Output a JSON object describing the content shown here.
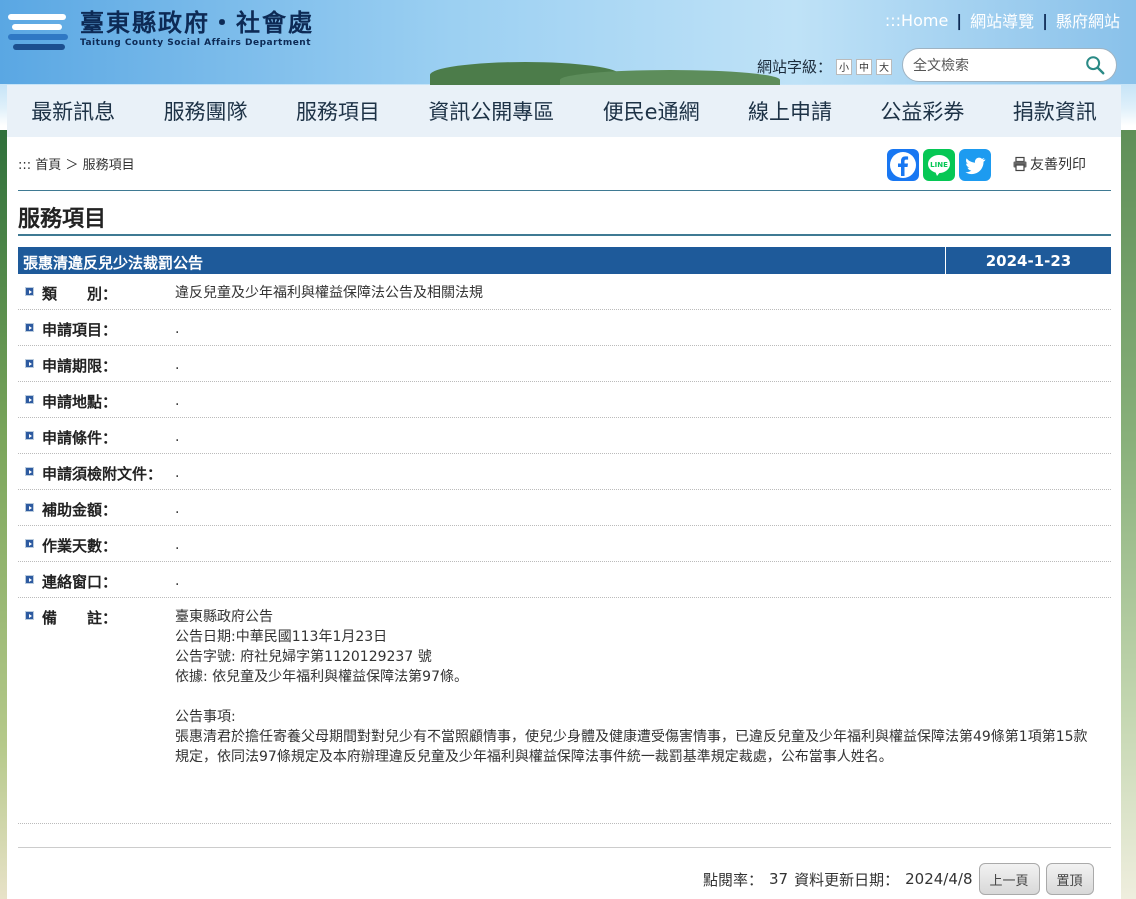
{
  "site": {
    "title": "臺東縣政府‧社會處",
    "subtitle": "Taitung County Social Affairs Department"
  },
  "toplinks": [
    ":::Home",
    "網站導覽",
    "縣府網站"
  ],
  "fontsize": {
    "label": "網站字級：",
    "small": "小",
    "medium": "中",
    "large": "大"
  },
  "search": {
    "placeholder": "全文檢索"
  },
  "nav": [
    "最新訊息",
    "服務團隊",
    "服務項目",
    "資訊公開專區",
    "便民e通網",
    "線上申請",
    "公益彩券",
    "捐款資訊"
  ],
  "breadcrumb": {
    "prefix": "::: ",
    "home": "首頁",
    "sep": " ＞ ",
    "current": "服務項目"
  },
  "print_label": "友善列印",
  "page_title": "服務項目",
  "article": {
    "title": "張惠清違反兒少法裁罰公告",
    "date": "2024-1-23"
  },
  "rows": [
    {
      "label": "類　　別：",
      "value": "違反兒童及少年福利與權益保障法公告及相關法規"
    },
    {
      "label": "申請項目：",
      "value": "."
    },
    {
      "label": "申請期限：",
      "value": "."
    },
    {
      "label": "申請地點：",
      "value": "."
    },
    {
      "label": "申請條件：",
      "value": "."
    },
    {
      "label": "申請須檢附文件：",
      "value": "."
    },
    {
      "label": "補助金額：",
      "value": "."
    },
    {
      "label": "作業天數：",
      "value": "."
    },
    {
      "label": "連絡窗口：",
      "value": "."
    }
  ],
  "remark": {
    "label": "備　　註：",
    "lines": [
      "臺東縣政府公告",
      "公告日期:中華民國113年1月23日",
      "公告字號: 府社兒婦字第1120129237 號",
      "依據: 依兒童及少年福利與權益保障法第97條。",
      "",
      "公告事項:",
      "張惠清君於擔任寄養父母期間對對兒少有不當照顧情事，使兒少身體及健康遭受傷害情事，已違反兒童及少年福利與權益保障法第49條第1項第15款規定，依同法97條規定及本府辦理違反兒童及少年福利與權益保障法事件統一裁罰基準規定裁處，公布當事人姓名。"
    ]
  },
  "footer": {
    "hits_label": "點閱率：",
    "hits": "37",
    "updated_label": "資料更新日期：",
    "updated": "2024/4/8",
    "prev_button": "上一頁",
    "top_button": "置頂"
  },
  "colors": {
    "nav_bg": "#e9f1f8",
    "title_bar": "#1e5a9a",
    "rule": "#3f7a93"
  }
}
